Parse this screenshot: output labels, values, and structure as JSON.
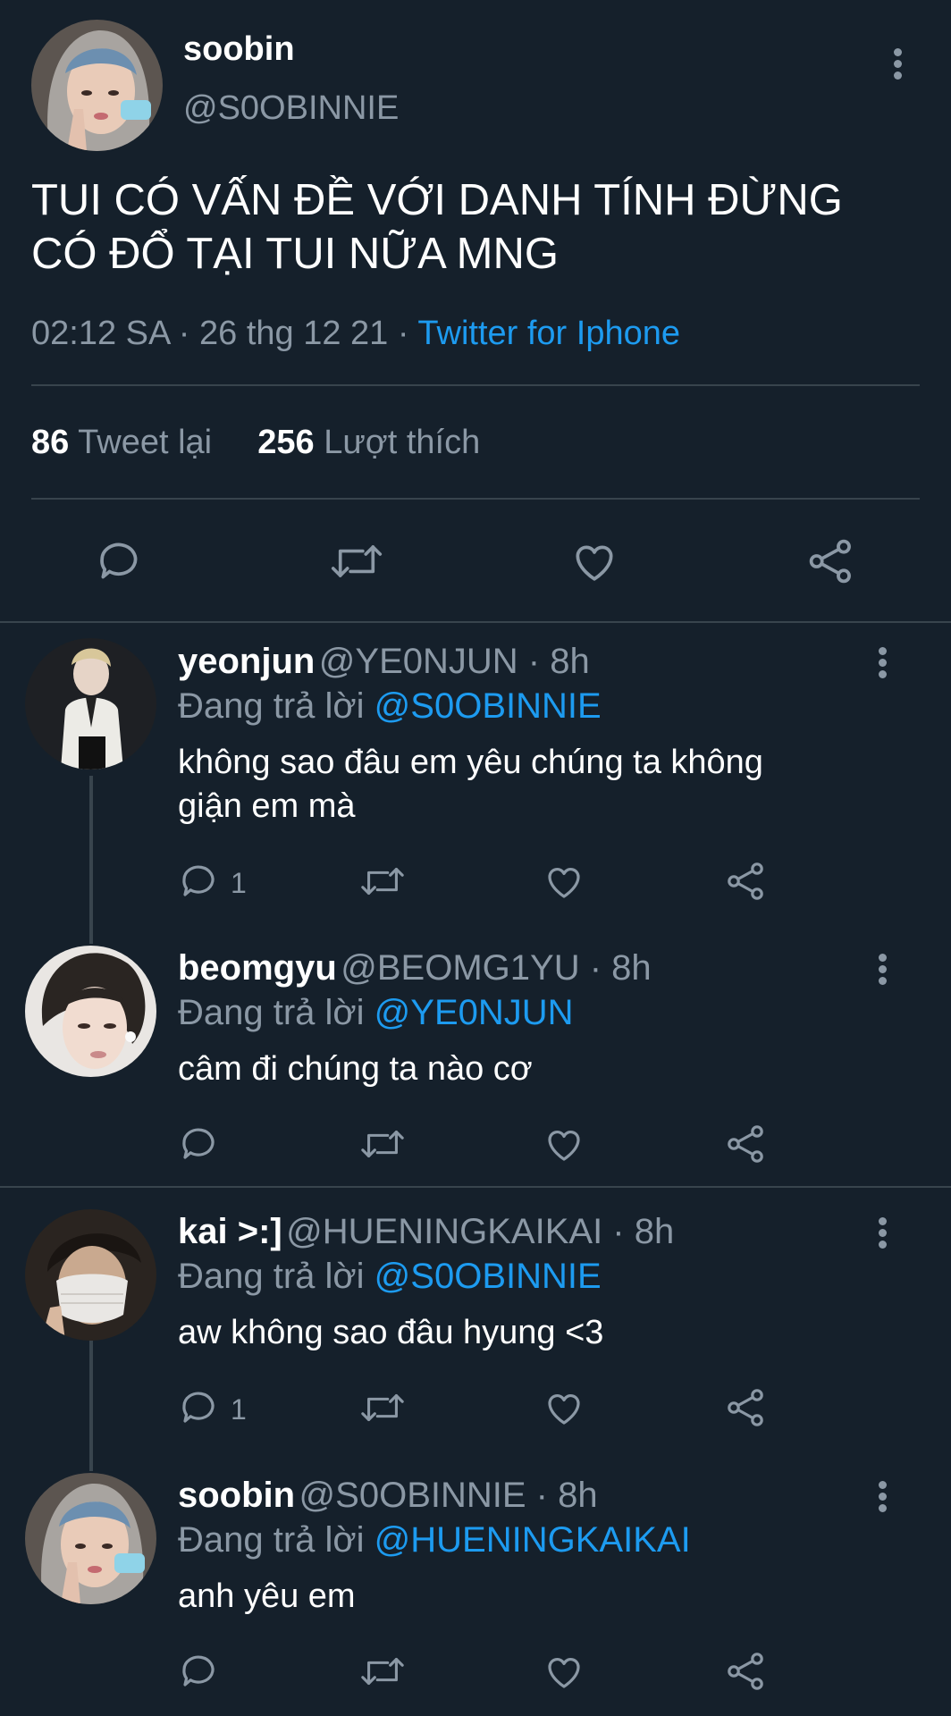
{
  "main_tweet": {
    "name": "soobin",
    "handle": "@S0OBINNIE",
    "text_line1": "TUI CÓ VẤN ĐỀ VỚI DANH TÍNH ĐỪNG",
    "text_line2": "CÓ ĐỔ TẠI TUI NỮA MNG",
    "time": "02:12 SA · 26 thg 12 21 ·",
    "source": "Twitter for Iphone",
    "retweets_count": "86",
    "retweets_label": "Tweet lại",
    "likes_count": "256",
    "likes_label": "Lượt thích"
  },
  "replies": [
    {
      "name": "yeonjun",
      "handle": "@YE0NJUN · 8h",
      "replying_label": "Đang trả lời",
      "replying_to": "@S0OBINNIE",
      "text_line1": "không sao đâu em yêu chúng ta không",
      "text_line2": "giận em mà",
      "reply_count": "1"
    },
    {
      "name": "beomgyu",
      "handle": "@BEOMG1YU · 8h",
      "replying_label": "Đang trả lời",
      "replying_to": "@YE0NJUN",
      "text_line1": "câm đi chúng ta nào cơ",
      "reply_count": ""
    },
    {
      "name": "kai >:]",
      "handle": "@HUENINGKAIKAI · 8h",
      "replying_label": "Đang trả lời",
      "replying_to": "@S0OBINNIE",
      "text_line1": "aw không sao đâu hyung <3",
      "reply_count": "1"
    },
    {
      "name": "soobin",
      "handle": "@S0OBINNIE · 8h",
      "replying_label": "Đang trả lời",
      "replying_to": "@HUENINGKAIKAI",
      "text_line1": "anh yêu em",
      "reply_count": ""
    }
  ],
  "icons": {
    "reply": "speech-bubble-icon",
    "retweet": "retweet-arrows-icon",
    "like": "heart-icon",
    "share": "share-nodes-icon",
    "more": "vertical-dots-icon"
  },
  "colors": {
    "background": "#15202b",
    "accent": "#1d9bf0",
    "muted": "#8b98a5",
    "divider": "#38444d"
  }
}
